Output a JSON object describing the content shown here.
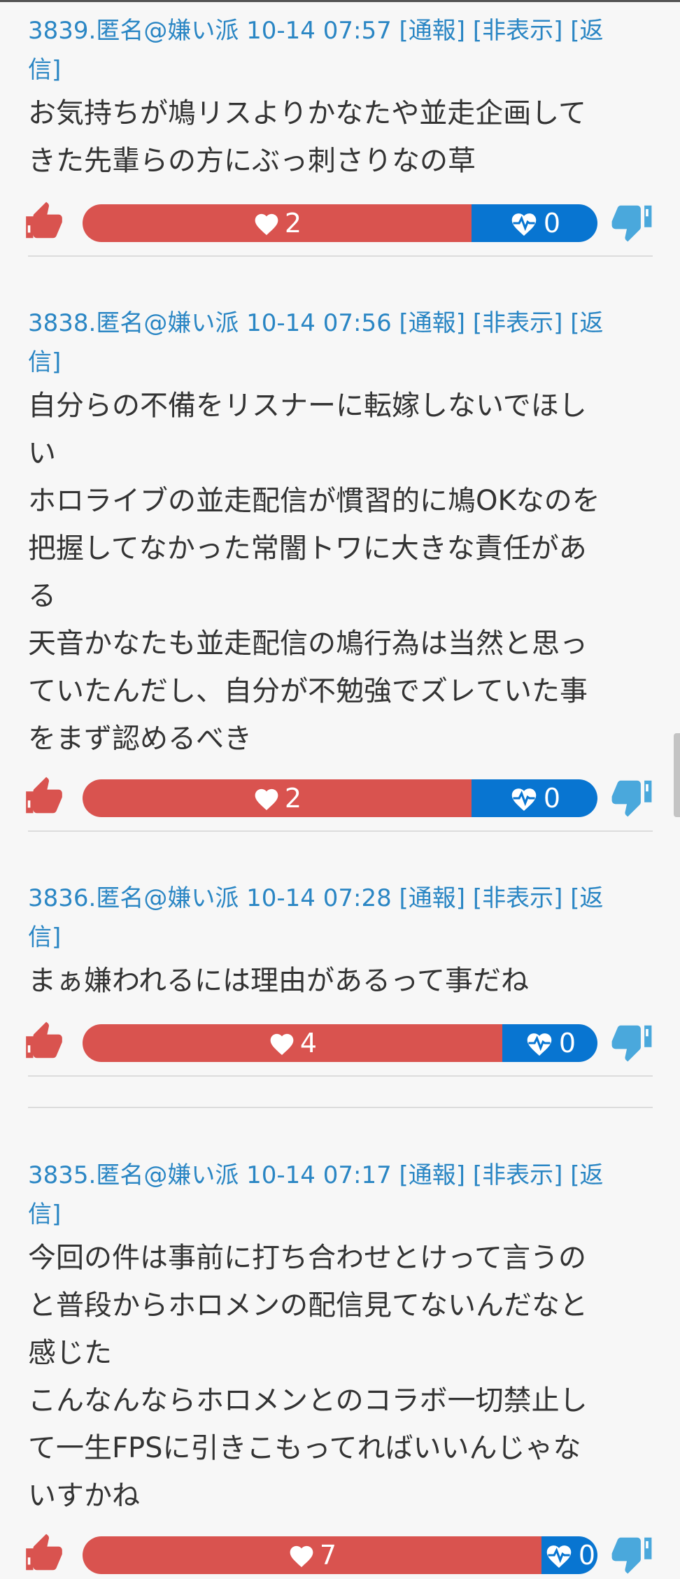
{
  "header_links": {
    "report": "[通報]",
    "hide": "[非表示]",
    "reply": "[返信]"
  },
  "colors": {
    "good": "#d9534f",
    "bad": "#0875d1",
    "link": "#2a86c4",
    "thumb_up": "#d9534f",
    "thumb_down": "#4aa8dc"
  },
  "icons": {
    "up": "thumbs-up-icon",
    "down": "thumbs-down-icon",
    "good": "heart-icon",
    "bad": "heartbeat-icon"
  },
  "comments": [
    {
      "meta": "3839.匿名@嫌い派 10-14 07:57",
      "lines": [
        "お気持ちが鳩リスよりかなたや並走企画して",
        "きた先輩らの方にぶっ刺さりなの草"
      ],
      "good": 2,
      "bad": 0
    },
    {
      "meta": "3838.匿名@嫌い派 10-14 07:56",
      "lines": [
        "自分らの不備をリスナーに転嫁しないでほし",
        "い",
        "ホロライブの並走配信が慣習的に鳩OKなのを",
        "把握してなかった常闇トワに大きな責任があ",
        "る",
        "天音かなたも並走配信の鳩行為は当然と思っ",
        "ていたんだし、自分が不勉強でズレていた事",
        "をまず認めるべき"
      ],
      "good": 2,
      "bad": 0
    },
    {
      "meta": "3836.匿名@嫌い派 10-14 07:28",
      "lines": [
        "まぁ嫌われるには理由があるって事だね"
      ],
      "good": 4,
      "bad": 0
    },
    {
      "meta": "3835.匿名@嫌い派 10-14 07:17",
      "lines": [
        "今回の件は事前に打ち合わせとけって言うの",
        "と普段からホロメンの配信見てないんだなと",
        "感じた",
        "こんなんならホロメンとのコラボ一切禁止し",
        "て一生FPSに引きこもってればいいんじゃな",
        "いすかね"
      ],
      "good": 7,
      "bad": 0
    }
  ]
}
